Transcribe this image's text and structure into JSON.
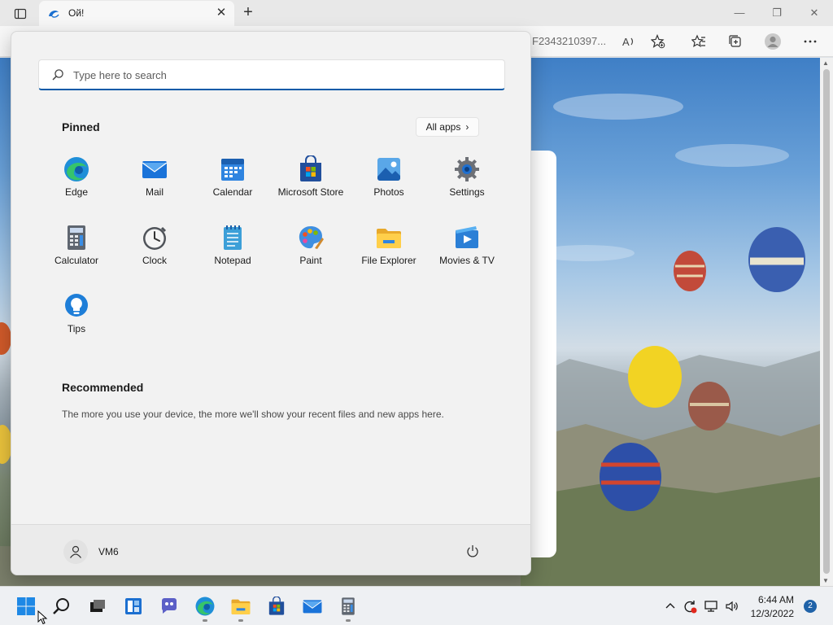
{
  "browser": {
    "tab_title": "Ой!",
    "address_fragment": "F2343210397...",
    "close_glyph": "✕",
    "new_tab_glyph": "+",
    "window_controls": {
      "minimize": "—",
      "restore": "❐",
      "close": "✕"
    }
  },
  "start_menu": {
    "search_placeholder": "Type here to search",
    "pinned_heading": "Pinned",
    "all_apps_label": "All apps",
    "all_apps_chevron": "›",
    "pinned_apps": [
      {
        "label": "Edge",
        "icon": "edge-icon"
      },
      {
        "label": "Mail",
        "icon": "mail-icon"
      },
      {
        "label": "Calendar",
        "icon": "calendar-icon"
      },
      {
        "label": "Microsoft Store",
        "icon": "store-icon"
      },
      {
        "label": "Photos",
        "icon": "photos-icon"
      },
      {
        "label": "Settings",
        "icon": "settings-icon"
      },
      {
        "label": "Calculator",
        "icon": "calculator-icon"
      },
      {
        "label": "Clock",
        "icon": "clock-icon"
      },
      {
        "label": "Notepad",
        "icon": "notepad-icon"
      },
      {
        "label": "Paint",
        "icon": "paint-icon"
      },
      {
        "label": "File Explorer",
        "icon": "file-explorer-icon"
      },
      {
        "label": "Movies & TV",
        "icon": "movies-tv-icon"
      },
      {
        "label": "Tips",
        "icon": "tips-icon"
      }
    ],
    "recommended_heading": "Recommended",
    "recommended_text": "The more you use your device, the more we'll show your recent files and new apps here.",
    "user_name": "VM6"
  },
  "taskbar": {
    "apps": [
      "start-icon",
      "search-icon",
      "task-view-icon",
      "widgets-icon",
      "chat-icon",
      "edge-icon",
      "file-explorer-icon",
      "store-icon",
      "mail-icon",
      "calculator-icon"
    ],
    "time": "6:44 AM",
    "date": "12/3/2022",
    "notification_count": "2"
  },
  "colors": {
    "accent": "#0a5aa8",
    "sky": "#6aa1d8",
    "taskbar": "#eef0f3"
  }
}
